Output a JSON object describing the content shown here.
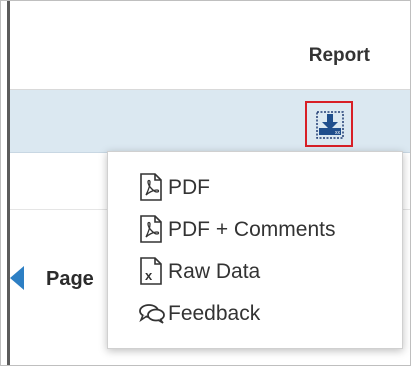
{
  "header": {
    "column_title": "Report"
  },
  "row": {
    "download_icon": "download-icon"
  },
  "pager": {
    "label": "Page"
  },
  "menu": {
    "items": [
      {
        "label": "PDF",
        "icon": "pdf-icon"
      },
      {
        "label": "PDF + Comments",
        "icon": "pdf-comments-icon"
      },
      {
        "label": "Raw Data",
        "icon": "excel-icon"
      },
      {
        "label": "Feedback",
        "icon": "feedback-icon"
      }
    ]
  },
  "colors": {
    "accent": "#2d7fc4",
    "highlight_border": "#d81f26",
    "row_selected": "#dbe8f1"
  }
}
